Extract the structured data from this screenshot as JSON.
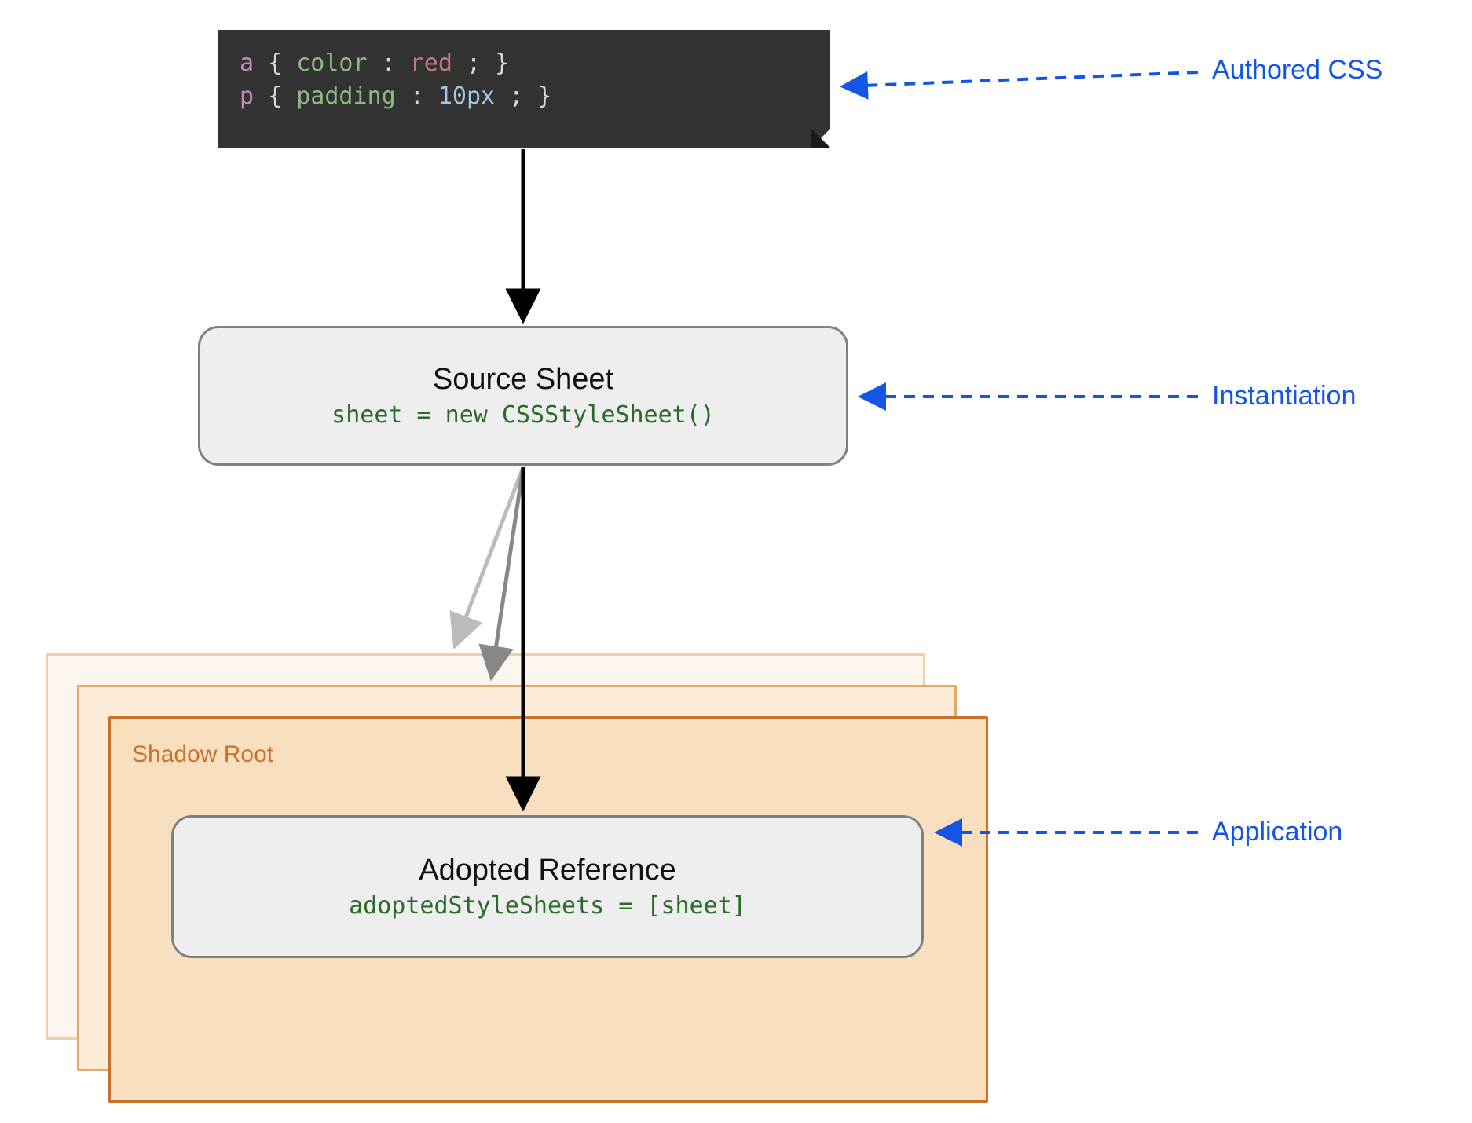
{
  "code": {
    "line1": {
      "selector": "a",
      "open": "{",
      "prop": "color",
      "colon": ":",
      "value": "red",
      "semi": ";",
      "close": "}"
    },
    "line2": {
      "selector": "p",
      "open": "{",
      "prop": "padding",
      "colon": ":",
      "value": "10px",
      "semi": ";",
      "close": "}"
    }
  },
  "source_box": {
    "title": "Source Sheet",
    "code": "sheet = new CSSStyleSheet()"
  },
  "shadow_root_label": "Shadow Root",
  "adopted_box": {
    "title": "Adopted Reference",
    "code": "adoptedStyleSheets = [sheet]"
  },
  "annotations": {
    "authored": "Authored CSS",
    "instantiation": "Instantiation",
    "application": "Application"
  }
}
